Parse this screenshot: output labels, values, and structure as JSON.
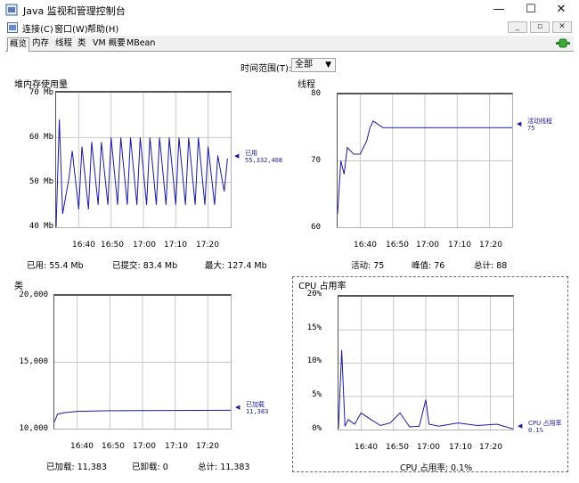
{
  "window": {
    "title": "Java 监视和管理控制台",
    "controls": [
      "—",
      "☐",
      "✕"
    ]
  },
  "menubar": {
    "items": [
      "连接(C)",
      "窗口(W)",
      "帮助(H)"
    ],
    "mdi_controls": [
      "_",
      "▫",
      "✕"
    ]
  },
  "tabs": [
    "概览",
    "内存",
    "线程",
    "类",
    "VM 概要",
    "MBean"
  ],
  "toolbar": {
    "range_label": "时间范围(T):",
    "range_value": "全部"
  },
  "x_ticks": [
    "16:40",
    "16:50",
    "17:00",
    "17:10",
    "17:20"
  ],
  "charts": {
    "heap": {
      "title": "堆内存使用量",
      "y_labels": [
        "70 Mb",
        "60 Mb",
        "50 Mb",
        "40 Mb"
      ],
      "legend_name": "已用",
      "legend_value": "55,332,408",
      "stats": [
        "已用: 55.4 Mb",
        "已提交: 83.4 Mb",
        "最大: 127.4 Mb"
      ]
    },
    "threads": {
      "title": "线程",
      "y_labels": [
        "80",
        "70",
        "60"
      ],
      "legend_name": "活动线程",
      "legend_value": "75",
      "stats": [
        "活动: 75",
        "峰值: 76",
        "总计: 88"
      ]
    },
    "classes": {
      "title": "类",
      "y_labels": [
        "20,000",
        "15,000",
        "10,000"
      ],
      "legend_name": "已加载",
      "legend_value": "11,383",
      "stats": [
        "已加载: 11,383",
        "已卸载: 0",
        "总计: 11,383"
      ]
    },
    "cpu": {
      "title": "CPU 占用率",
      "y_labels": [
        "20%",
        "15%",
        "10%",
        "5%",
        "0%"
      ],
      "legend_name": "CPU 占用率",
      "legend_value": "0.1%",
      "stats": [
        "CPU 占用率: 0.1%"
      ]
    }
  },
  "colors": {
    "series": "#1a1aa0",
    "grid": "#c8c8c8",
    "panel_border": "#909090"
  },
  "chart_data": [
    {
      "type": "line",
      "title": "堆内存使用量",
      "x": [
        "16:33",
        "16:34",
        "16:35",
        "16:37",
        "16:38",
        "16:40",
        "16:41",
        "16:43",
        "16:44",
        "16:46",
        "16:47",
        "16:49",
        "16:50",
        "16:52",
        "16:53",
        "16:55",
        "16:56",
        "16:58",
        "16:59",
        "17:01",
        "17:02",
        "17:04",
        "17:05",
        "17:07",
        "17:08",
        "17:10",
        "17:11",
        "17:13",
        "17:14",
        "17:16",
        "17:17",
        "17:19",
        "17:20",
        "17:22",
        "17:23",
        "17:25",
        "17:26"
      ],
      "series": [
        {
          "name": "已用",
          "values": [
            40,
            64,
            43,
            51,
            57,
            44,
            58,
            44,
            59,
            45,
            59,
            45,
            60,
            45,
            60,
            45,
            60,
            45,
            60,
            45,
            60,
            45,
            60,
            45,
            60,
            45,
            60,
            45,
            60,
            45,
            60,
            45,
            58,
            45,
            56,
            48,
            55.3
          ]
        }
      ],
      "ylim": [
        40,
        70
      ],
      "ylabel": "Mb"
    },
    {
      "type": "line",
      "title": "线程",
      "x": [
        "16:33",
        "16:34",
        "16:35",
        "16:36",
        "16:38",
        "16:40",
        "16:42",
        "16:43",
        "16:44",
        "16:47",
        "17:00",
        "17:27"
      ],
      "series": [
        {
          "name": "活动线程",
          "values": [
            62,
            70,
            68,
            72,
            71,
            71,
            73,
            75,
            76,
            75,
            75,
            75
          ]
        }
      ],
      "ylim": [
        60,
        80
      ]
    },
    {
      "type": "line",
      "title": "类",
      "x": [
        "16:33",
        "16:34",
        "16:36",
        "16:40",
        "16:50",
        "17:27"
      ],
      "series": [
        {
          "name": "已加载",
          "values": [
            10500,
            11100,
            11200,
            11300,
            11350,
            11383
          ]
        }
      ],
      "ylim": [
        10000,
        20000
      ]
    },
    {
      "type": "line",
      "title": "CPU 占用率",
      "x": [
        "16:33",
        "16:34",
        "16:35",
        "16:36",
        "16:38",
        "16:40",
        "16:43",
        "16:46",
        "16:49",
        "16:52",
        "16:55",
        "16:58",
        "17:00",
        "17:01",
        "17:04",
        "17:10",
        "17:16",
        "17:22",
        "17:27"
      ],
      "series": [
        {
          "name": "CPU 占用率",
          "values": [
            0.2,
            12,
            0.5,
            1.5,
            0.8,
            2.5,
            1.5,
            0.6,
            1.0,
            2.5,
            0.4,
            0.5,
            4.5,
            0.8,
            0.5,
            1.0,
            0.6,
            0.8,
            0.1
          ]
        }
      ],
      "ylim": [
        0,
        20
      ],
      "ylabel": "%"
    }
  ]
}
